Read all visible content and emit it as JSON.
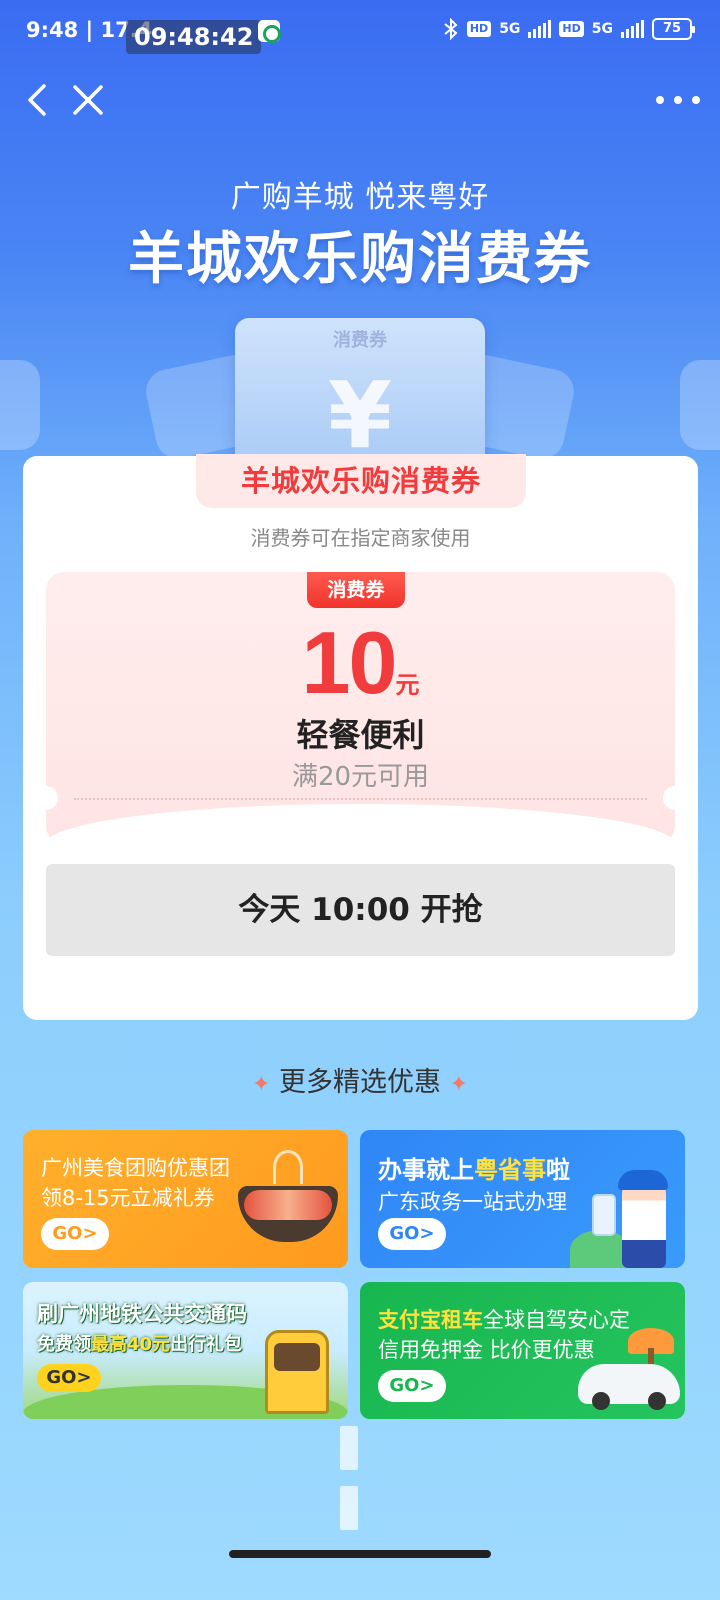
{
  "status_bar": {
    "time": "9:48",
    "speed": "| 17.4",
    "clock_overlay": "09:48:42",
    "net1": "5G",
    "net2": "5G",
    "hd": "HD",
    "battery": "75"
  },
  "nav": {
    "back_icon": "chevron-left-icon",
    "close_icon": "close-icon",
    "more_icon": "more-dots-icon"
  },
  "hero": {
    "subtitle": "广购羊城 悦来粤好",
    "title": "羊城欢乐购消费券",
    "card_label": "消费券",
    "card_symbol": "¥"
  },
  "voucher": {
    "tag": "羊城欢乐购消费券",
    "description": "消费券可在指定商家使用",
    "badge": "消费券",
    "amount": "10",
    "unit": "元",
    "name": "轻餐便利",
    "condition": "满20元可用",
    "grab_button": "今天 10:00 开抢"
  },
  "more": {
    "title": "更多精选优惠",
    "spark": "✦"
  },
  "promos": [
    {
      "line1": "广州美食团购优惠团",
      "line2": "领8-15元立减礼券",
      "go": "GO>"
    },
    {
      "line1_a": "办事就上",
      "line1_b": "粤省事",
      "line1_c": "啦",
      "line2": "广东政务一站式办理",
      "go": "GO>"
    },
    {
      "line1": "刷广州地铁公共交通码",
      "line2_a": "免费领",
      "line2_b": "最高40元",
      "line2_c": "出行礼包",
      "go": "GO>"
    },
    {
      "line1_a": "支付宝租车",
      "line1_b": "全球自驾安心定",
      "line2": "信用免押金 比价更优惠",
      "go": "GO>"
    }
  ],
  "colors": {
    "accent_red": "#f03c3c",
    "bg_blue": "#3a6cf2",
    "promo_orange": "#ffa526",
    "promo_blue": "#2f86f6",
    "promo_green": "#18b64f"
  }
}
